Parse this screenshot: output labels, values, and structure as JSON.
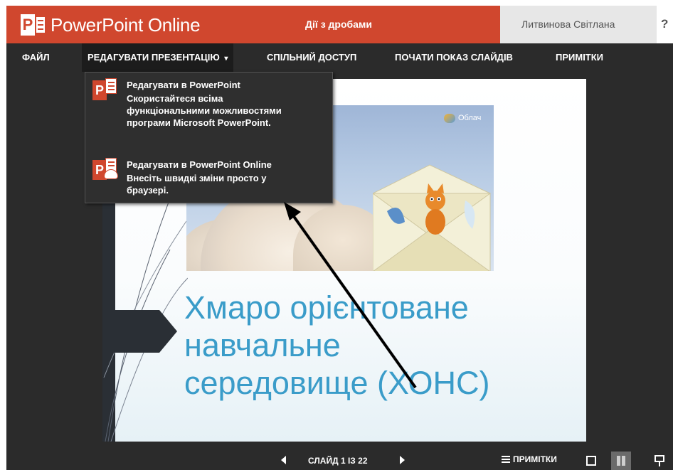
{
  "app": {
    "name": "PowerPoint Online",
    "document_title": "Дії з дробами",
    "user_name": "Литвинова Світлана",
    "help": "?"
  },
  "menu": {
    "file": "ФАЙЛ",
    "edit": "РЕДАГУВАТИ ПРЕЗЕНТАЦІЮ",
    "edit_chevron": "▾",
    "share": "СПІЛЬНИЙ ДОСТУП",
    "slideshow": "ПОЧАТИ ПОКАЗ СЛАЙДІВ",
    "notes": "ПРИМІТКИ"
  },
  "dropdown": {
    "items": [
      {
        "title": "Редагувати в PowerPoint",
        "description": "Скористайтеся всіма функціональними можливостями програми Microsoft PowerPoint.",
        "icon": "powerpoint-desktop-icon"
      },
      {
        "title": "Редагувати в PowerPoint Online",
        "description": "Внесіть швидкі зміни просто у браузері.",
        "icon": "powerpoint-online-icon"
      }
    ]
  },
  "slide": {
    "title_lines": [
      "Хмаро орієнтоване",
      "навчальне",
      "середовище (ХОНС)"
    ],
    "photo_label": "Облач"
  },
  "status": {
    "slide_counter": "СЛАЙД 1 ІЗ 22",
    "notes": "ПРИМІТКИ"
  },
  "colors": {
    "brand": "#d0472e",
    "menubar": "#2b2b2b",
    "slide_title": "#3a9cc9"
  }
}
